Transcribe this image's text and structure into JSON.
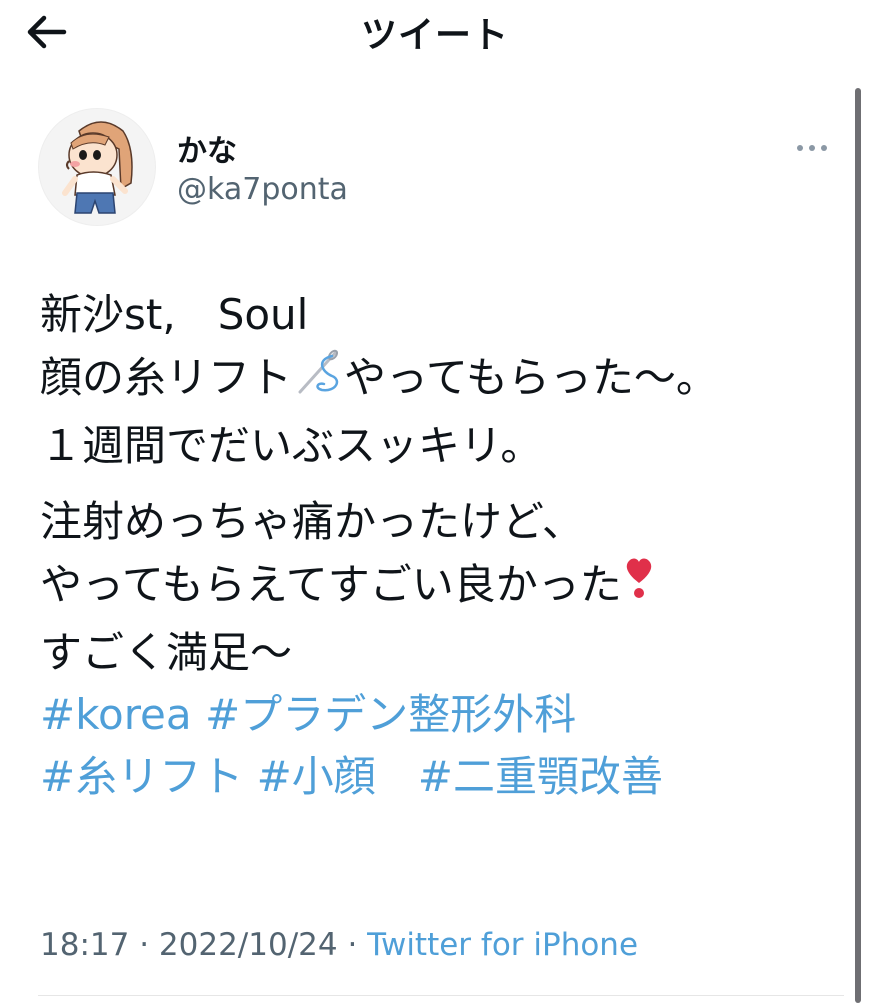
{
  "header": {
    "title": "ツイート",
    "back_icon": "arrow-left-icon"
  },
  "tweet": {
    "display_name": "かな",
    "handle": "@ka7ponta",
    "more_icon": "more-horizontal-icon",
    "lines": {
      "l1": "新沙st,　Soul",
      "l2a": "顔の糸リフト",
      "l2b": "やってもらった〜。",
      "l3": "１週間でだいぶスッキリ。",
      "l4": "注射めっちゃ痛かったけど、",
      "l5": "やってもらえてすごい良かった",
      "l6": "すごく満足〜"
    },
    "hashtags": {
      "korea": "#korea",
      "pladen": "#プラデン整形外科",
      "itolift": "#糸リフト",
      "kogao": "#小顔",
      "nijuu": "#二重顎改善"
    },
    "emoji": {
      "thread": "thread-needle-emoji",
      "heart": "heart-exclamation-emoji"
    },
    "meta": {
      "time": "18:17",
      "sep": " · ",
      "date": "2022/10/24",
      "source": "Twitter for iPhone"
    }
  },
  "colors": {
    "link": "#4f9fd8",
    "secondary_text": "#536471",
    "text": "#0f1419",
    "heart": "#e0304a"
  }
}
